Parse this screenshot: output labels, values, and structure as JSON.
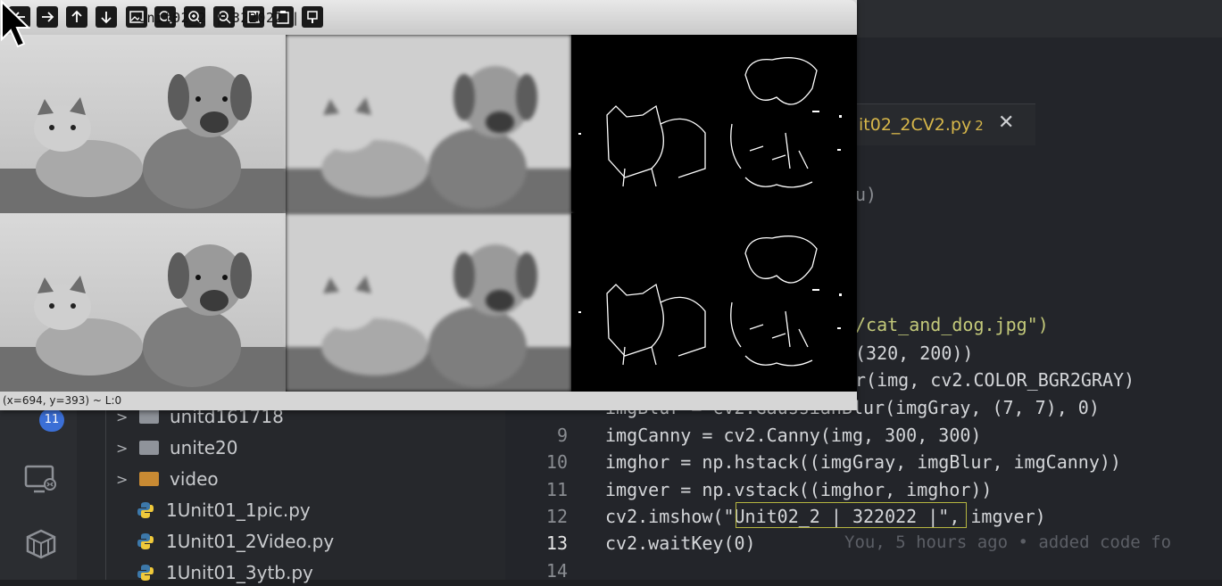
{
  "cv_window": {
    "title": "Unit02_2 | 322022 |",
    "status": "(x=694, y=393) ~ L:0",
    "toolbar_icons": [
      "arrow-left-icon",
      "arrow-right-icon",
      "arrow-up-icon",
      "arrow-down-icon",
      "image-icon",
      "zoom-fit-icon",
      "zoom-in-icon",
      "zoom-out-icon",
      "save-icon",
      "copy-icon",
      "properties-icon"
    ]
  },
  "tab": {
    "label": "it02_2CV2.py",
    "badge": "2",
    "close": "✕"
  },
  "editor": {
    "partial_lines": [
      {
        "text": "u)"
      },
      {
        "text": "/cat_and_dog.jpg\")"
      },
      {
        "text": "(320, 200))"
      },
      {
        "text": "r(img, cv2.COLOR_BGR2GRAY)"
      },
      {
        "text": "imgBlur = cv2.GaussianBlur(imgGray, (7, 7), 0)"
      }
    ],
    "lines": [
      {
        "num": "9",
        "text": "imgCanny = cv2.Canny(img, 300, 300)"
      },
      {
        "num": "10",
        "text": "imghor = np.hstack((imgGray, imgBlur, imgCanny))"
      },
      {
        "num": "11",
        "text": "imgver = np.vstack((imghor, imghor))"
      },
      {
        "num": "12",
        "text": "cv2.imshow(\"Unit02_2 | 322022 |\", imgver)"
      },
      {
        "num": "13",
        "text": "cv2.waitKey(0)"
      },
      {
        "num": "14",
        "text": ""
      }
    ],
    "blame": "You, 5 hours ago • added code fo"
  },
  "explorer": {
    "items": [
      {
        "label": "unitd161718",
        "kind": "folder"
      },
      {
        "label": "unite20",
        "kind": "folder"
      },
      {
        "label": "video",
        "kind": "folder-orange"
      },
      {
        "label": "1Unit01_1pic.py",
        "kind": "python"
      },
      {
        "label": "1Unit01_2Video.py",
        "kind": "python"
      },
      {
        "label": "1Unit01_3ytb.py",
        "kind": "python"
      }
    ]
  },
  "activity": {
    "badge": "11"
  },
  "colors": {
    "string": "#c3c97a",
    "number": "#d08a4b",
    "tab_label": "#d7b74a",
    "badge": "#3b6fd6"
  }
}
